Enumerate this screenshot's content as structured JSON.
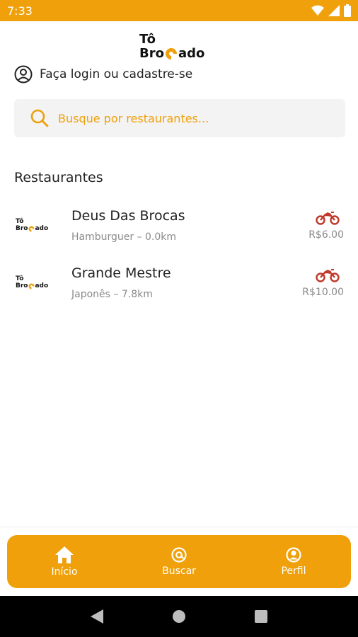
{
  "status_bar": {
    "time": "7:33"
  },
  "logo": {
    "line1": "Tô",
    "line2_left": "Bro",
    "line2_right": "ado"
  },
  "login": {
    "text": "Faça login ou cadastre-se",
    "icon": "user-circle-icon"
  },
  "search": {
    "placeholder": "Busque por restaurantes...",
    "icon": "search-icon"
  },
  "section": {
    "title": "Restaurantes"
  },
  "restaurants": [
    {
      "name": "Deus Das Brocas",
      "meta": "Hamburguer – 0.0km",
      "fee": "R$6.00"
    },
    {
      "name": "Grande Mestre",
      "meta": "Japonês – 7.8km",
      "fee": "R$10.00"
    }
  ],
  "bottom_nav": [
    {
      "label": "Início",
      "icon": "home-icon"
    },
    {
      "label": "Buscar",
      "icon": "at-search-icon"
    },
    {
      "label": "Perfil",
      "icon": "profile-icon"
    }
  ],
  "colors": {
    "brand": "#EFA00B",
    "moto": "#C0392B"
  }
}
